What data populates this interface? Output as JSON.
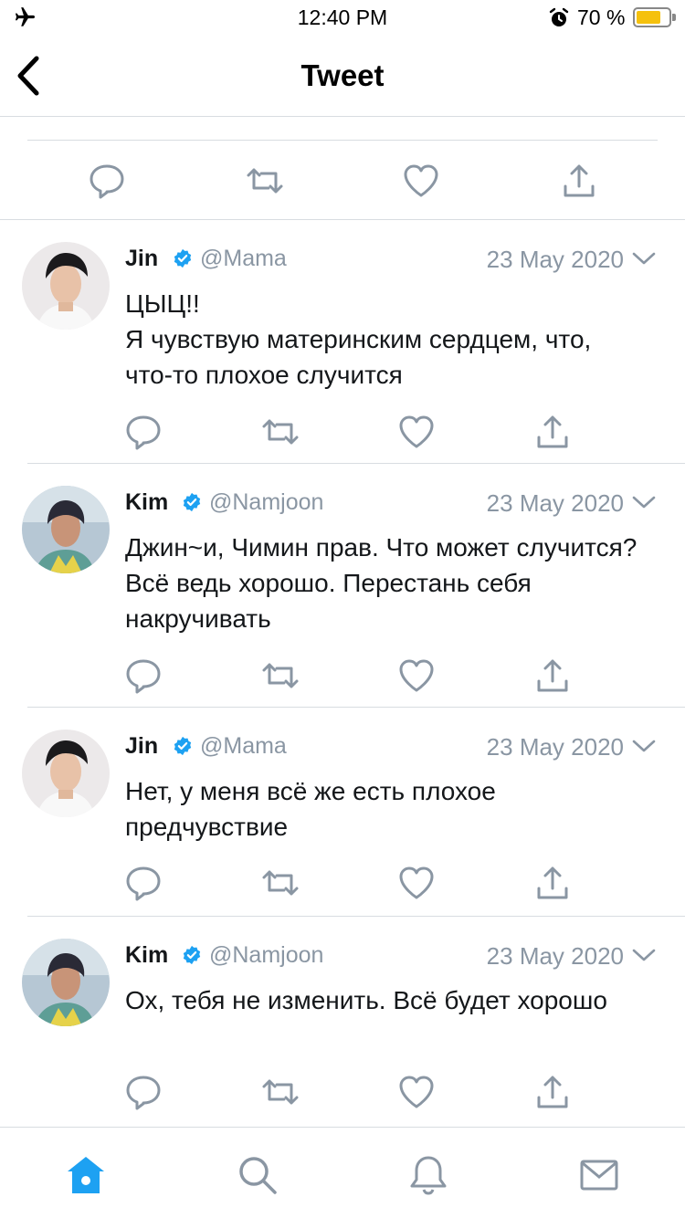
{
  "status_bar": {
    "time": "12:40 PM",
    "battery_percent": "70 %",
    "battery_level": 0.7,
    "icons": [
      "airplane-mode-icon",
      "alarm-icon",
      "battery-icon"
    ]
  },
  "nav": {
    "title": "Tweet",
    "back_icon": "chevron-left-icon"
  },
  "colors": {
    "accent": "#1da1f2",
    "text": "#14171a",
    "muted": "#8a96a3",
    "divider": "#d8dde1",
    "battery": "#f5c10d"
  },
  "actions": [
    "reply-icon",
    "retweet-icon",
    "like-icon",
    "share-icon"
  ],
  "tweets": [
    {
      "name": "Jin",
      "handle": "@Mama",
      "date": "23 May 2020",
      "text": "ЦЫЦ!!\nЯ чувствую материнским сердцем, что, что-то плохое случится"
    },
    {
      "name": "Kim",
      "handle": "@Namjoon",
      "date": "23 May 2020",
      "text": "Джин~и, Чимин прав. Что может случится? Всё ведь хорошо. Перестань себя накручивать"
    },
    {
      "name": "Jin",
      "handle": "@Mama",
      "date": "23 May 2020",
      "text": "Нет, у меня всё же есть плохое предчувствие"
    },
    {
      "name": "Kim",
      "handle": "@Namjoon",
      "date": "23 May 2020",
      "text": "Ох, тебя не изменить. Всё будет хорошо"
    }
  ],
  "tab_bar": {
    "items": [
      "home-icon",
      "search-icon",
      "notifications-icon",
      "messages-icon"
    ],
    "active": "home-icon"
  }
}
